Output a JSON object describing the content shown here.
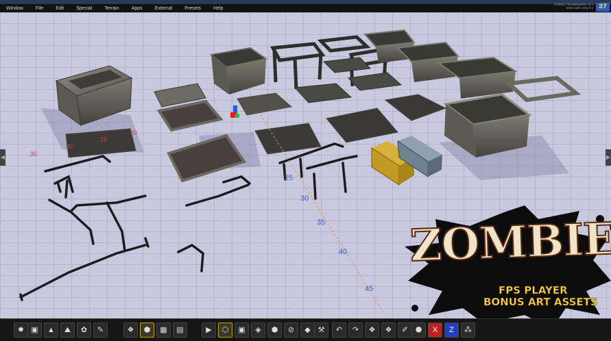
{
  "menu": [
    "Window",
    "File",
    "Edit",
    "Special",
    "Terrain",
    "Apps",
    "External",
    "Presets",
    "Help"
  ],
  "build_info": [
    "ATOMIC FRAMEWORK v3.x",
    "Made with Unity 5.x"
  ],
  "fps": "37",
  "grid_numbers_blue": [
    "25",
    "30",
    "35",
    "40",
    "45"
  ],
  "grid_numbers_red": [
    "35",
    "30",
    "25",
    "20"
  ],
  "logo": {
    "title": "ZOMBIE",
    "line1": "FPS PLAYER",
    "line2": "BONUS ART ASSETS"
  },
  "toolbar": {
    "buttons": [
      {
        "icon": "gear-icon",
        "glyph": "✹"
      },
      {
        "icon": "save-icon",
        "glyph": "▣"
      },
      {
        "icon": "landscape-icon",
        "glyph": "▲"
      },
      {
        "icon": "terrain-icon",
        "glyph": "⛰"
      },
      {
        "icon": "flower-icon",
        "glyph": "✿"
      },
      {
        "icon": "paint-icon",
        "glyph": "✎"
      },
      {
        "icon": "objects-icon",
        "glyph": "❖"
      },
      {
        "icon": "cube-icon",
        "glyph": "⬢"
      },
      {
        "icon": "grid-icon",
        "glyph": "▦"
      },
      {
        "icon": "layers-icon",
        "glyph": "▤"
      },
      {
        "icon": "play-icon",
        "glyph": "▶"
      },
      {
        "icon": "select-icon",
        "glyph": "⬡"
      },
      {
        "icon": "box-icon",
        "glyph": "▣"
      },
      {
        "icon": "crate-icon",
        "glyph": "◈"
      },
      {
        "icon": "package-icon",
        "glyph": "⬢"
      },
      {
        "icon": "no-entry-icon",
        "glyph": "⊘"
      },
      {
        "icon": "item-icon",
        "glyph": "◆"
      },
      {
        "icon": "weapon-icon",
        "glyph": "⚒"
      },
      {
        "icon": "undo-icon",
        "glyph": "↶"
      },
      {
        "icon": "redo-icon",
        "glyph": "↷"
      },
      {
        "icon": "cubes-icon",
        "glyph": "❖"
      },
      {
        "icon": "cubes2-icon",
        "glyph": "❖"
      },
      {
        "icon": "brush-icon",
        "glyph": "✐"
      },
      {
        "icon": "entity-icon",
        "glyph": "⬣"
      },
      {
        "icon": "x-axis-icon",
        "glyph": "X"
      },
      {
        "icon": "z-axis-icon",
        "glyph": "Z"
      },
      {
        "icon": "group-icon",
        "glyph": "⁂"
      }
    ]
  },
  "colors": {
    "grid_bg": "#c9c8df",
    "toolbar_bg": "#161616",
    "accent_gold": "#ffd44a",
    "logo_cream": "#efe3c8"
  }
}
